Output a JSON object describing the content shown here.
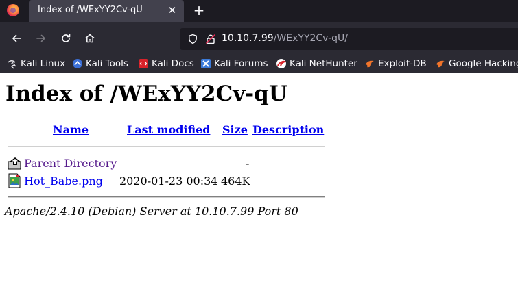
{
  "browser": {
    "tab": {
      "title": "Index of /WExYY2Cv-qU",
      "close_glyph": "✕"
    },
    "new_tab_glyph": "+",
    "url": {
      "host": "10.10.7.99",
      "path": "/WExYY2Cv-qU/"
    },
    "bookmarks": [
      {
        "label": "Kali Linux",
        "icon": "kali-dragon-icon"
      },
      {
        "label": "Kali Tools",
        "icon": "kali-tools-icon"
      },
      {
        "label": "Kali Docs",
        "icon": "kali-docs-icon"
      },
      {
        "label": "Kali Forums",
        "icon": "kali-forums-icon"
      },
      {
        "label": "Kali NetHunter",
        "icon": "kali-nethunter-icon"
      },
      {
        "label": "Exploit-DB",
        "icon": "exploit-db-icon"
      },
      {
        "label": "Google Hacking",
        "icon": "google-hacking-icon"
      }
    ],
    "colors": {
      "tabbar": "#1c1b22",
      "navbar": "#2b2a33",
      "active_tab": "#42414d"
    }
  },
  "page": {
    "title": "Index of /WExYY2Cv-qU",
    "columns": {
      "name": "Name",
      "last_modified": "Last modified",
      "size": "Size",
      "description": "Description"
    },
    "parent": {
      "name": "Parent Directory",
      "size": "-",
      "icon": "back-folder-icon"
    },
    "files": [
      {
        "name": "Hot_Babe.png",
        "modified": "2020-01-23 00:34",
        "size": "464K",
        "icon": "image-file-icon"
      }
    ],
    "footer": "Apache/2.4.10 (Debian) Server at 10.10.7.99 Port 80",
    "colors": {
      "link": "#0000ee",
      "visited_link": "#551a8b"
    }
  }
}
